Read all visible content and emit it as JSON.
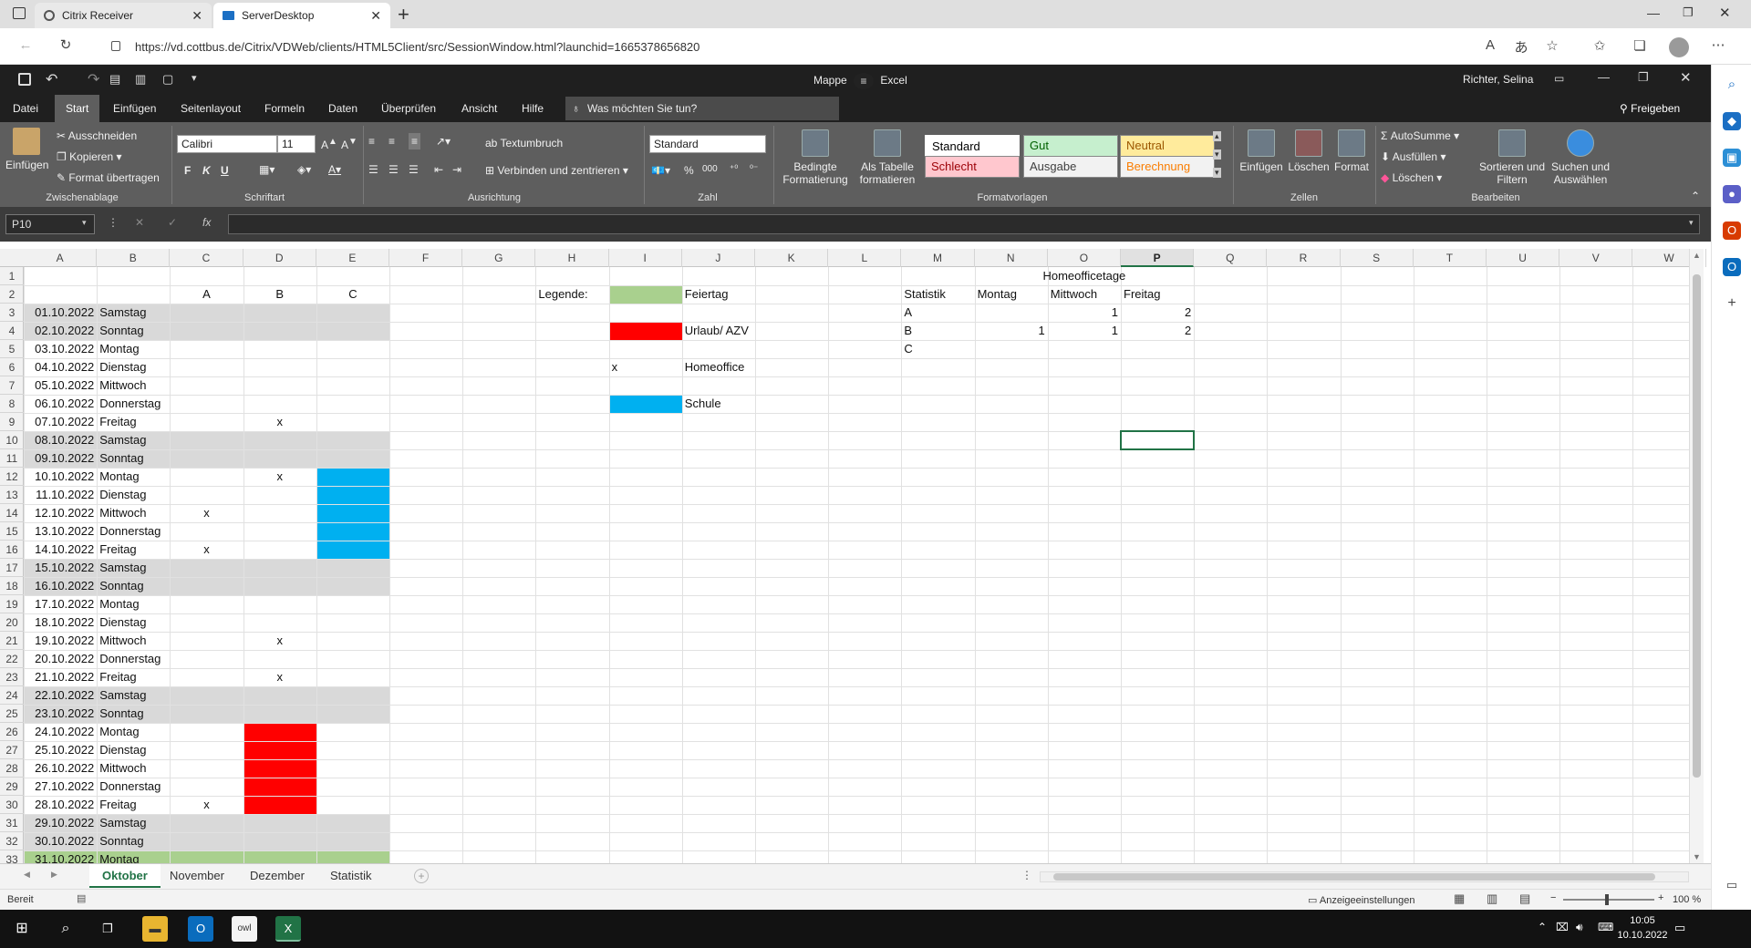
{
  "browser": {
    "tabs": [
      {
        "label": "Citrix Receiver",
        "icon": "citrix-icon"
      },
      {
        "label": "ServerDesktop",
        "icon": "desktop-icon"
      }
    ],
    "url": "https://vd.cottbus.de/Citrix/VDWeb/clients/HTML5Client/src/SessionWindow.html?launchid=1665378656820"
  },
  "excel": {
    "title_left": "Mappe",
    "title_right": "Excel",
    "user": "Richter, Selina",
    "menu": [
      "Datei",
      "Start",
      "Einfügen",
      "Seitenlayout",
      "Formeln",
      "Daten",
      "Überprüfen",
      "Ansicht",
      "Hilfe"
    ],
    "active_menu": "Start",
    "tellme": "Was möchten Sie tun?",
    "share": "Freigeben",
    "ribbon": {
      "clipboard": {
        "label": "Zwischenablage",
        "paste": "Einfügen",
        "cut": "Ausschneiden",
        "copy": "Kopieren",
        "format_painter": "Format übertragen"
      },
      "font": {
        "label": "Schriftart",
        "family": "Calibri",
        "size": "11",
        "bold": "F",
        "italic": "K",
        "underline": "U"
      },
      "alignment": {
        "label": "Ausrichtung",
        "wrap": "Textumbruch",
        "merge": "Verbinden und zentrieren"
      },
      "number": {
        "label": "Zahl",
        "format": "Standard",
        "percent": "%",
        "thousands": "000"
      },
      "styles": {
        "label": "Formatvorlagen",
        "conditional": "Bedingte Formatierung",
        "as_table": "Als Tabelle formatieren",
        "items": [
          {
            "label": "Standard",
            "bg": "#ffffff",
            "fg": "#000000"
          },
          {
            "label": "Gut",
            "bg": "#c6efce",
            "fg": "#006100"
          },
          {
            "label": "Neutral",
            "bg": "#ffeb9c",
            "fg": "#9c5700"
          },
          {
            "label": "Schlecht",
            "bg": "#ffc7ce",
            "fg": "#9c0006"
          },
          {
            "label": "Ausgabe",
            "bg": "#f2f2f2",
            "fg": "#3f3f3f"
          },
          {
            "label": "Berechnung",
            "bg": "#f2f2f2",
            "fg": "#fa7d00"
          }
        ]
      },
      "cells": {
        "label": "Zellen",
        "insert": "Einfügen",
        "delete": "Löschen",
        "format": "Format"
      },
      "editing": {
        "label": "Bearbeiten",
        "autosum": "AutoSumme",
        "fill": "Ausfüllen",
        "clear": "Löschen",
        "sort": "Sortieren und Filtern",
        "find": "Suchen und Auswählen"
      }
    },
    "namebox": "P10",
    "columns": [
      "A",
      "B",
      "C",
      "D",
      "E",
      "F",
      "G",
      "H",
      "I",
      "J",
      "K",
      "L",
      "M",
      "N",
      "O",
      "P",
      "Q",
      "R",
      "S",
      "T",
      "U",
      "V",
      "W"
    ],
    "selected_column": "P",
    "rows": [
      "1",
      "2",
      "3",
      "4",
      "5",
      "6",
      "7",
      "8",
      "9",
      "10",
      "11",
      "12",
      "13",
      "14",
      "15",
      "16",
      "17",
      "18",
      "19",
      "20",
      "21",
      "22",
      "23",
      "24",
      "25",
      "26",
      "27",
      "28",
      "29",
      "30",
      "31",
      "32",
      "33"
    ],
    "headers_row2": {
      "C": "A",
      "D": "B",
      "E": "C"
    },
    "days": [
      {
        "date": "01.10.2022",
        "day": "Samstag"
      },
      {
        "date": "02.10.2022",
        "day": "Sonntag"
      },
      {
        "date": "03.10.2022",
        "day": "Montag"
      },
      {
        "date": "04.10.2022",
        "day": "Dienstag"
      },
      {
        "date": "05.10.2022",
        "day": "Mittwoch"
      },
      {
        "date": "06.10.2022",
        "day": "Donnerstag"
      },
      {
        "date": "07.10.2022",
        "day": "Freitag"
      },
      {
        "date": "08.10.2022",
        "day": "Samstag"
      },
      {
        "date": "09.10.2022",
        "day": "Sonntag"
      },
      {
        "date": "10.10.2022",
        "day": "Montag"
      },
      {
        "date": "11.10.2022",
        "day": "Dienstag"
      },
      {
        "date": "12.10.2022",
        "day": "Mittwoch"
      },
      {
        "date": "13.10.2022",
        "day": "Donnerstag"
      },
      {
        "date": "14.10.2022",
        "day": "Freitag"
      },
      {
        "date": "15.10.2022",
        "day": "Samstag"
      },
      {
        "date": "16.10.2022",
        "day": "Sonntag"
      },
      {
        "date": "17.10.2022",
        "day": "Montag"
      },
      {
        "date": "18.10.2022",
        "day": "Dienstag"
      },
      {
        "date": "19.10.2022",
        "day": "Mittwoch"
      },
      {
        "date": "20.10.2022",
        "day": "Donnerstag"
      },
      {
        "date": "21.10.2022",
        "day": "Freitag"
      },
      {
        "date": "22.10.2022",
        "day": "Samstag"
      },
      {
        "date": "23.10.2022",
        "day": "Sonntag"
      },
      {
        "date": "24.10.2022",
        "day": "Montag"
      },
      {
        "date": "25.10.2022",
        "day": "Dienstag"
      },
      {
        "date": "26.10.2022",
        "day": "Mittwoch"
      },
      {
        "date": "27.10.2022",
        "day": "Donnerstag"
      },
      {
        "date": "28.10.2022",
        "day": "Freitag"
      },
      {
        "date": "29.10.2022",
        "day": "Samstag"
      },
      {
        "date": "30.10.2022",
        "day": "Sonntag"
      },
      {
        "date": "31.10.2022",
        "day": "Montag"
      }
    ],
    "marks": [
      {
        "row": 9,
        "col": "D",
        "text": "x"
      },
      {
        "row": 12,
        "col": "D",
        "text": "x"
      },
      {
        "row": 14,
        "col": "C",
        "text": "x"
      },
      {
        "row": 16,
        "col": "C",
        "text": "x"
      },
      {
        "row": 21,
        "col": "D",
        "text": "x"
      },
      {
        "row": 23,
        "col": "D",
        "text": "x"
      },
      {
        "row": 30,
        "col": "C",
        "text": "x"
      }
    ],
    "colors": {
      "weekend": "#d9d9d9",
      "holiday": "#a9d08e",
      "vacation": "#ff0000",
      "school": "#00b0f0",
      "excel_green": "#217346"
    },
    "legend": {
      "title": "Legende:",
      "items": [
        {
          "row": 2,
          "swatch": "holiday",
          "label": "Feiertag"
        },
        {
          "row": 4,
          "swatch": "vacation",
          "label": "Urlaub/ AZV"
        },
        {
          "row": 6,
          "swatch": "x",
          "label": "Homeoffice"
        },
        {
          "row": 8,
          "swatch": "school",
          "label": "Schule"
        }
      ]
    },
    "stats": {
      "title": "Homeofficetage",
      "header": [
        "Statistik",
        "Montag",
        "Mittwoch",
        "Freitag"
      ],
      "rows": [
        {
          "name": "A",
          "values": [
            "",
            "1",
            "2"
          ]
        },
        {
          "name": "B",
          "values": [
            "1",
            "1",
            "2"
          ]
        },
        {
          "name": "C",
          "values": [
            "",
            "",
            ""
          ]
        }
      ]
    },
    "sheets": [
      "Oktober",
      "November",
      "Dezember",
      "Statistik"
    ],
    "active_sheet": "Oktober",
    "status": {
      "ready": "Bereit",
      "display": "Anzeigeeinstellungen",
      "zoom": "100 %"
    }
  },
  "taskbar": {
    "time": "10:05",
    "date": "10.10.2022"
  }
}
